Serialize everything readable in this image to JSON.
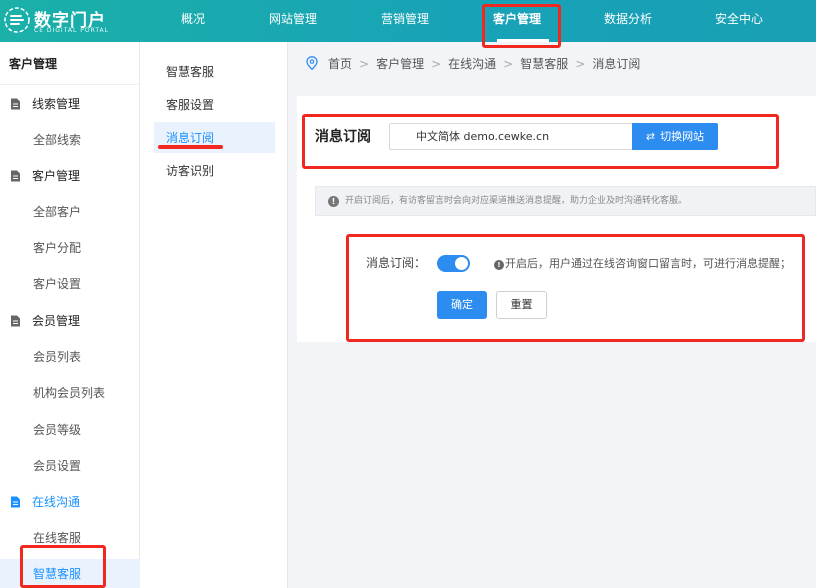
{
  "logo": {
    "title": "数字门户",
    "subtitle": "CE DIGITAL PORTAL"
  },
  "topnav": [
    {
      "label": "概况"
    },
    {
      "label": "网站管理"
    },
    {
      "label": "营销管理"
    },
    {
      "label": "客户管理"
    },
    {
      "label": "数据分析"
    },
    {
      "label": "安全中心"
    }
  ],
  "sidebar": {
    "title": "客户管理",
    "groups": [
      {
        "label": "线索管理",
        "items": [
          "全部线索"
        ]
      },
      {
        "label": "客户管理",
        "items": [
          "全部客户",
          "客户分配",
          "客户设置"
        ]
      },
      {
        "label": "会员管理",
        "items": [
          "会员列表",
          "机构会员列表",
          "会员等级",
          "会员设置"
        ]
      },
      {
        "label": "在线沟通",
        "items": [
          "在线客服",
          "智慧客服"
        ]
      }
    ]
  },
  "subnav": [
    "智慧客服",
    "客服设置",
    "消息订阅",
    "访客识别"
  ],
  "breadcrumb": [
    "首页",
    "客户管理",
    "在线沟通",
    "智慧客服",
    "消息订阅"
  ],
  "main": {
    "title": "消息订阅",
    "site_value": "中文简体 demo.cewke.cn",
    "switch_label": "切换网站",
    "notice": "开启订阅后，有访客留言时会向对应渠道推送消息提醒，助力企业及时沟通转化客服。",
    "form_label": "消息订阅：",
    "toggle_on": true,
    "hint": "开启后，用户通过在线咨询窗口留言时，可进行消息提醒；",
    "confirm_label": "确定",
    "reset_label": "重置"
  },
  "colors": {
    "accent": "#2d8cf0",
    "topbar": "#17a2b8",
    "annotation": "#f0281f"
  }
}
